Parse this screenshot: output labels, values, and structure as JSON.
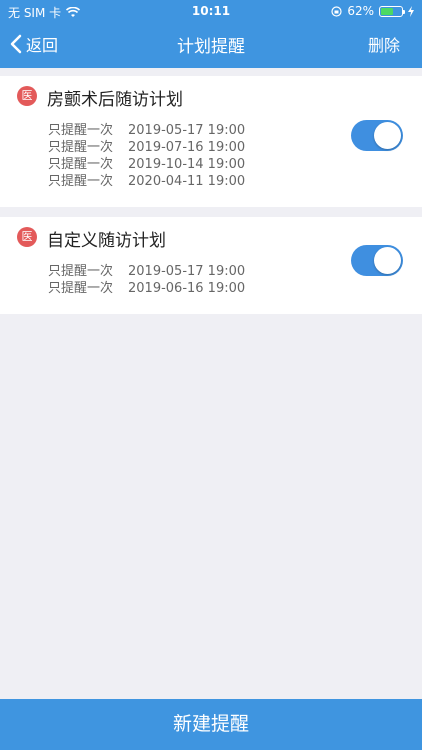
{
  "status_bar": {
    "carrier": "无 SIM 卡",
    "time": "10:11",
    "battery_percent": "62%",
    "battery_level": 0.62
  },
  "nav": {
    "back_label": "返回",
    "title": "计划提醒",
    "delete_label": "删除"
  },
  "plans": [
    {
      "badge": "医",
      "title": "房颤术后随访计划",
      "enabled": true,
      "reminders": [
        {
          "freq": "只提醒一次",
          "datetime": "2019-05-17 19:00"
        },
        {
          "freq": "只提醒一次",
          "datetime": "2019-07-16 19:00"
        },
        {
          "freq": "只提醒一次",
          "datetime": "2019-10-14 19:00"
        },
        {
          "freq": "只提醒一次",
          "datetime": "2020-04-11 19:00"
        }
      ]
    },
    {
      "badge": "医",
      "title": "自定义随访计划",
      "enabled": true,
      "reminders": [
        {
          "freq": "只提醒一次",
          "datetime": "2019-05-17 19:00"
        },
        {
          "freq": "只提醒一次",
          "datetime": "2019-06-16 19:00"
        }
      ]
    }
  ],
  "footer": {
    "new_reminder_label": "新建提醒"
  },
  "colors": {
    "primary": "#3f95e0",
    "badge": "#e35a5a",
    "toggle_on": "#3f8fe0",
    "background": "#efeff4"
  }
}
